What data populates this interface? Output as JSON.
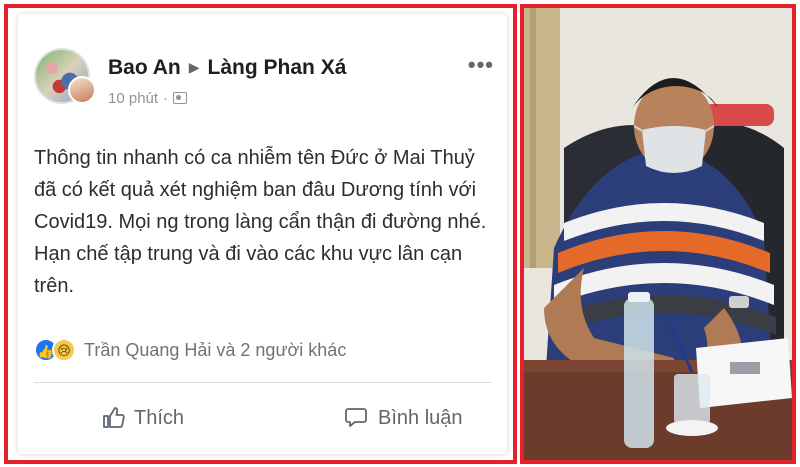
{
  "post": {
    "author": "Bao An",
    "group": "Làng Phan Xá",
    "time": "10 phút",
    "text": "Thông tin nhanh có ca nhiễm tên Đức ở Mai Thuỷ đã có kết quả xét nghiệm ban đâu Dương tính với Covid19. Mọi ng trong làng cẩn thận đi đường nhé. Hạn chế tập trung và đi vào các khu vực lân cạn trên.",
    "reactions_text": "Trần Quang Hải và 2 người khác",
    "reaction_icons": [
      "like-icon",
      "sad-icon"
    ],
    "more_icon": "more-options-icon"
  },
  "actions": {
    "like_label": "Thích",
    "comment_label": "Bình luận"
  },
  "colors": {
    "frame_border": "#e3222e",
    "facebook_blue": "#1877f2",
    "text_primary": "#1c1e21",
    "text_secondary": "#8d949e"
  },
  "photo": {
    "subject": "man-in-striped-shirt-wearing-mask-signing-document"
  }
}
